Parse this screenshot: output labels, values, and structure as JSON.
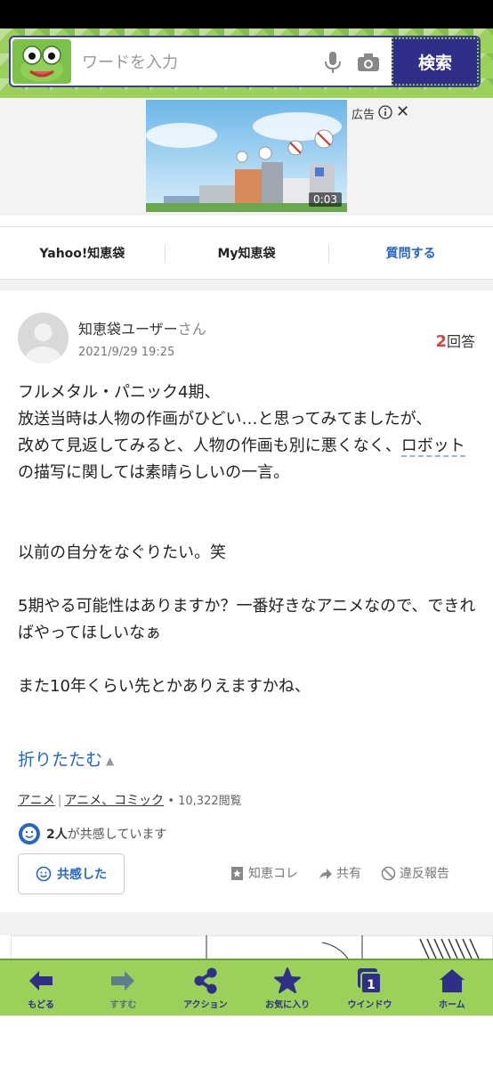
{
  "search": {
    "placeholder": "ワードを入力",
    "button_label": "検索"
  },
  "ad": {
    "label": "広告",
    "duration": "0:03"
  },
  "tabs": [
    {
      "label": "Yahoo!知恵袋"
    },
    {
      "label": "My知恵袋"
    },
    {
      "label": "質問する"
    }
  ],
  "answer": {
    "username": "知恵袋ユーザー",
    "honorific": "さん",
    "date": "2021/9/29 19:25",
    "answer_count_num": "2",
    "answer_count_suffix": "回答",
    "body_part1": "フルメタル・パニック4期、\n放送当時は人物の作画がひどい…と思ってみてましたが、\n改めて見返してみると、人物の作画も別に悪くなく、",
    "keyword": "ロボット",
    "body_part2": "の描写に関しては素晴らしいの一言。\n\n\n以前の自分をなぐりたい。笑\n\n5期やる可能性はありますか？一番好きなアニメなので、できればやってほしいなぁ\n\nまた10年くらい先とかありえますかね、",
    "fold_label": "折りたたむ",
    "category1": "アニメ",
    "category2": "アニメ、コミック",
    "views": "10,322閲覧",
    "empathy_count": "2人",
    "empathy_suffix": "が共感しています",
    "empathy_button": "共感した",
    "actions": {
      "chiekore": "知恵コレ",
      "share": "共有",
      "report": "違反報告"
    }
  },
  "bottom_nav": [
    {
      "label": "もどる",
      "icon": "back-arrow-icon"
    },
    {
      "label": "すすむ",
      "icon": "forward-arrow-icon"
    },
    {
      "label": "アクション",
      "icon": "share-icon"
    },
    {
      "label": "お気に入り",
      "icon": "star-icon"
    },
    {
      "label": "ウインドウ",
      "icon": "window-icon",
      "badge": "1"
    },
    {
      "label": "ホーム",
      "icon": "home-icon"
    }
  ],
  "colors": {
    "accent_blue": "#2566c7",
    "nav_green": "#9bd05a",
    "nav_dark": "#2f2f87",
    "count_red": "#d6453f"
  }
}
